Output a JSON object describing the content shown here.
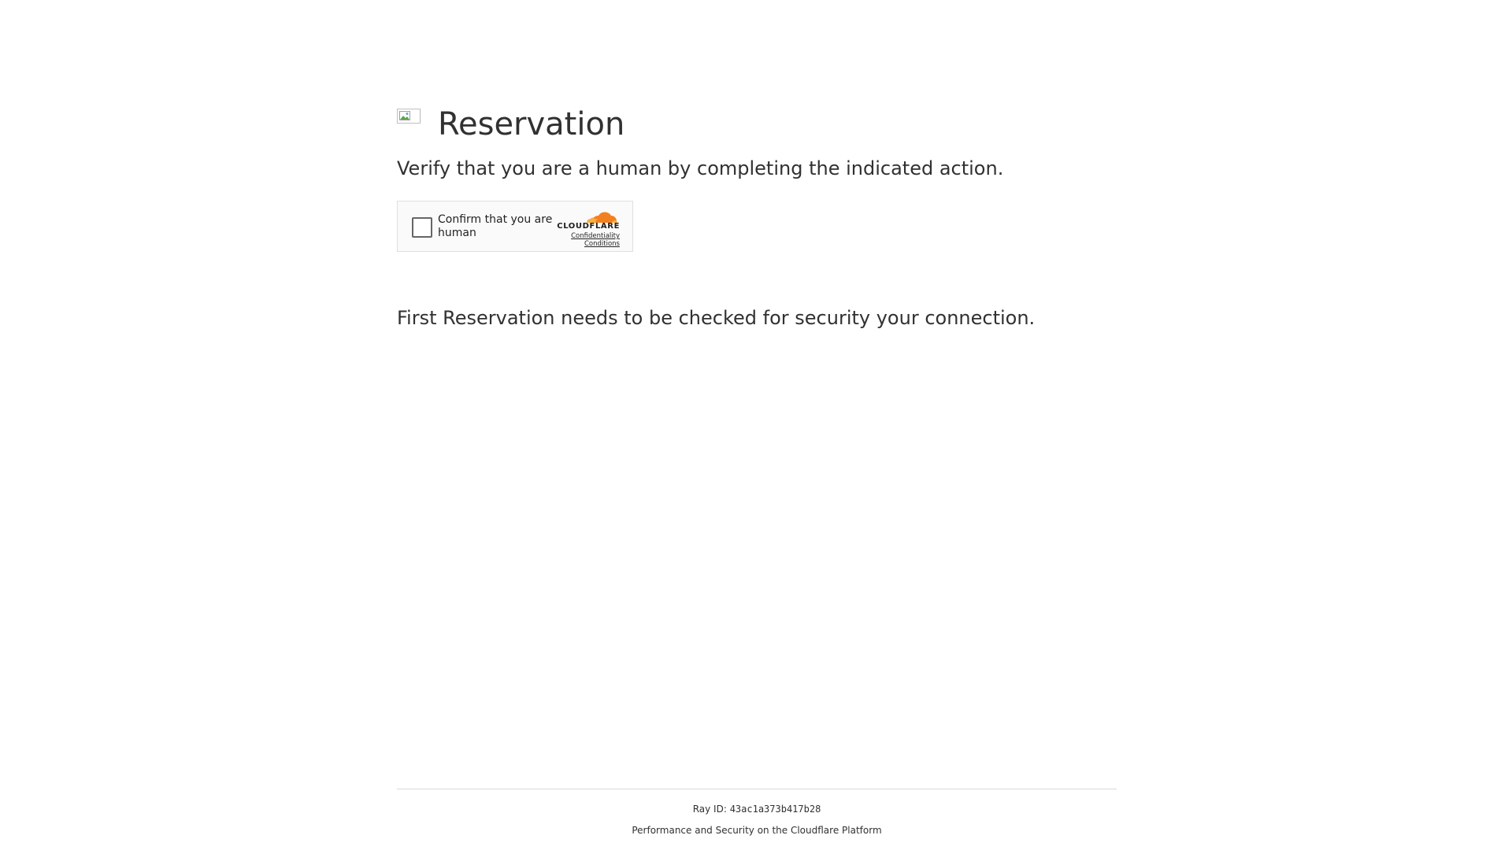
{
  "header": {
    "favicon_icon": "broken-image-icon",
    "title": "Reservation",
    "subtitle": "Verify that you are a human by completing the indicated action."
  },
  "challenge_widget": {
    "checkbox_label": "Confirm that you are human",
    "brand_icon": "cloudflare-cloud-icon",
    "brand_name": "CLOUDFLARE",
    "link_confidentiality": "Confidentiality",
    "link_conditions": "Conditions",
    "colors": {
      "brand_orange": "#f38020",
      "brand_light_orange": "#faae40"
    }
  },
  "body": {
    "security_message": "First Reservation needs to be checked for security your connection."
  },
  "footer": {
    "ray_label": "Ray ID:",
    "ray_id": "43ac1a373b417b28",
    "platform_text": "Performance and Security on the Cloudflare Platform"
  }
}
